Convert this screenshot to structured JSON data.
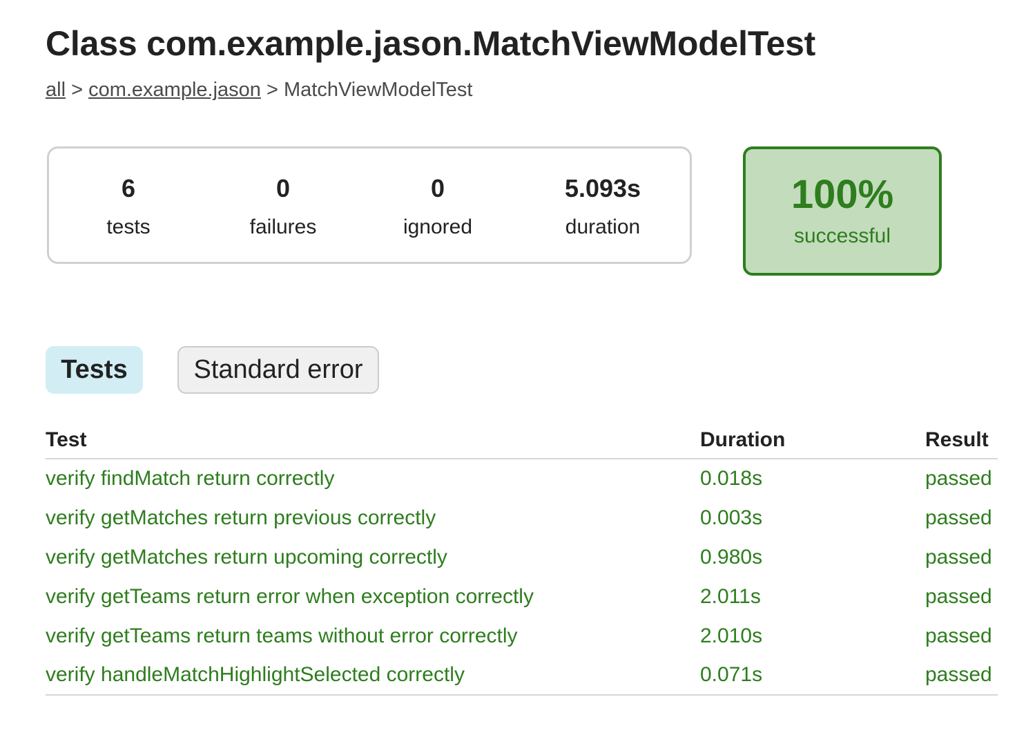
{
  "header": {
    "title": "Class com.example.jason.MatchViewModelTest"
  },
  "breadcrumb": {
    "items": [
      {
        "label": "all",
        "link": true
      },
      {
        "label": "com.example.jason",
        "link": true
      },
      {
        "label": "MatchViewModelTest",
        "link": false
      }
    ],
    "separator": ">"
  },
  "summary": {
    "tests": {
      "value": "6",
      "label": "tests"
    },
    "failures": {
      "value": "0",
      "label": "failures"
    },
    "ignored": {
      "value": "0",
      "label": "ignored"
    },
    "duration": {
      "value": "5.093s",
      "label": "duration"
    }
  },
  "success": {
    "percent": "100%",
    "label": "successful"
  },
  "tabs": [
    {
      "label": "Tests",
      "selected": true
    },
    {
      "label": "Standard error",
      "selected": false
    }
  ],
  "table": {
    "headers": {
      "test": "Test",
      "duration": "Duration",
      "result": "Result"
    },
    "rows": [
      {
        "test": "verify findMatch return correctly",
        "duration": "0.018s",
        "result": "passed"
      },
      {
        "test": "verify getMatches return previous correctly",
        "duration": "0.003s",
        "result": "passed"
      },
      {
        "test": "verify getMatches return upcoming correctly",
        "duration": "0.980s",
        "result": "passed"
      },
      {
        "test": "verify getTeams return error when exception correctly",
        "duration": "2.011s",
        "result": "passed"
      },
      {
        "test": "verify getTeams return teams without error correctly",
        "duration": "2.010s",
        "result": "passed"
      },
      {
        "test": "verify handleMatchHighlightSelected correctly",
        "duration": "0.071s",
        "result": "passed"
      }
    ]
  },
  "colors": {
    "success_green": "#2e7d1e",
    "success_bg": "#c3dcbc",
    "selected_tab_bg": "#d2eef4",
    "text": "#222222"
  }
}
